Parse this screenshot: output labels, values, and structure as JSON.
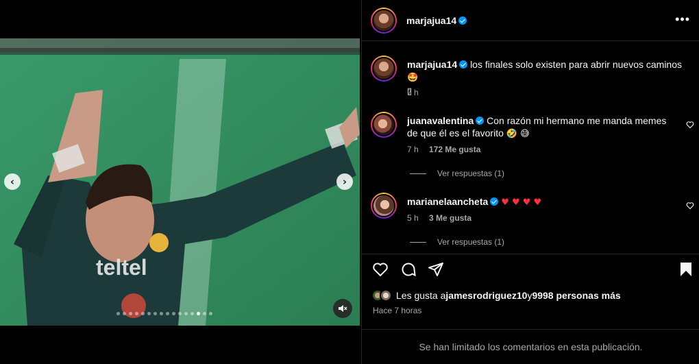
{
  "media": {
    "prev_label": "‹",
    "next_label": "›",
    "dots_total": 16,
    "dots_active_index": 13,
    "mute_icon": "speaker-muted-icon"
  },
  "header": {
    "username": "marjajua14",
    "more_label": "•••"
  },
  "caption": {
    "username": "marjajua14",
    "text": "los finales solo existen para abrir nuevos caminos",
    "emoji": "🤩",
    "extra": "▯",
    "time": "7 h"
  },
  "comments": [
    {
      "username": "juanavalentina",
      "text_line1": "Con razón mi hermano me manda memes",
      "text_line2": "de que él es el favorito",
      "emojis": "🤣 😅",
      "time": "7 h",
      "likes": "172 Me gusta",
      "replies": "Ver respuestas (1)"
    },
    {
      "username": "marianelaancheta",
      "text": "♥ ♥ ♥ ♥",
      "time": "5 h",
      "likes": "3 Me gusta",
      "replies": "Ver respuestas (1)"
    }
  ],
  "likes_summary": {
    "prefix": "Les gusta a ",
    "user": "jamesrodriguez10",
    "middle": " y ",
    "count": "9998 personas más"
  },
  "posted": "Hace 7 horas",
  "limited_text": "Se han limitado los comentarios en esta publicación.",
  "colors": {
    "background": "#000000",
    "text": "#f5f5f5",
    "muted": "#a8a8a8",
    "verified": "#0095f6",
    "heart": "#ff3040",
    "pitch": "#2f8f5c"
  }
}
